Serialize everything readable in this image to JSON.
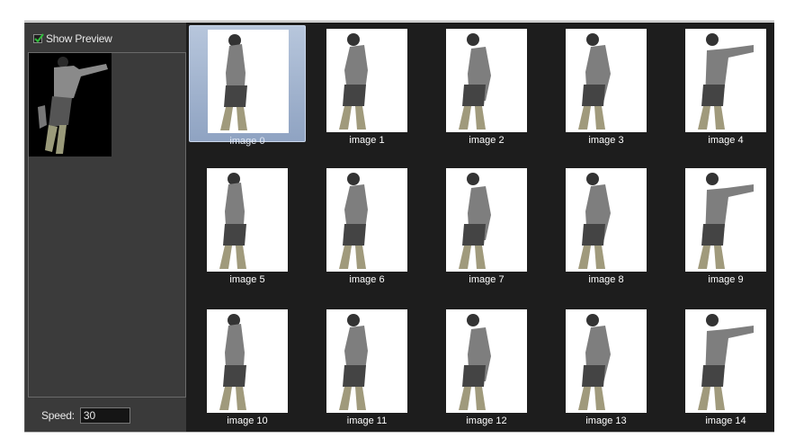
{
  "preview": {
    "show_preview_label": "Show Preview",
    "show_preview_checked": true,
    "speed_label": "Speed:",
    "speed_value": "30"
  },
  "thumbnails": [
    {
      "label": "image 0",
      "selected": true
    },
    {
      "label": "image 1",
      "selected": false
    },
    {
      "label": "image 2",
      "selected": false
    },
    {
      "label": "image 3",
      "selected": false
    },
    {
      "label": "image 4",
      "selected": false
    },
    {
      "label": "image 5",
      "selected": false
    },
    {
      "label": "image 6",
      "selected": false
    },
    {
      "label": "image 7",
      "selected": false
    },
    {
      "label": "image 8",
      "selected": false
    },
    {
      "label": "image 9",
      "selected": false
    },
    {
      "label": "image 10",
      "selected": false
    },
    {
      "label": "image 11",
      "selected": false
    },
    {
      "label": "image 12",
      "selected": false
    },
    {
      "label": "image 13",
      "selected": false
    },
    {
      "label": "image 14",
      "selected": false
    }
  ],
  "colors": {
    "panel": "#3a3a3a",
    "grid_background": "#1d1d1d",
    "selection": "#a3b4d0",
    "checkmark": "#2fbf3a"
  }
}
